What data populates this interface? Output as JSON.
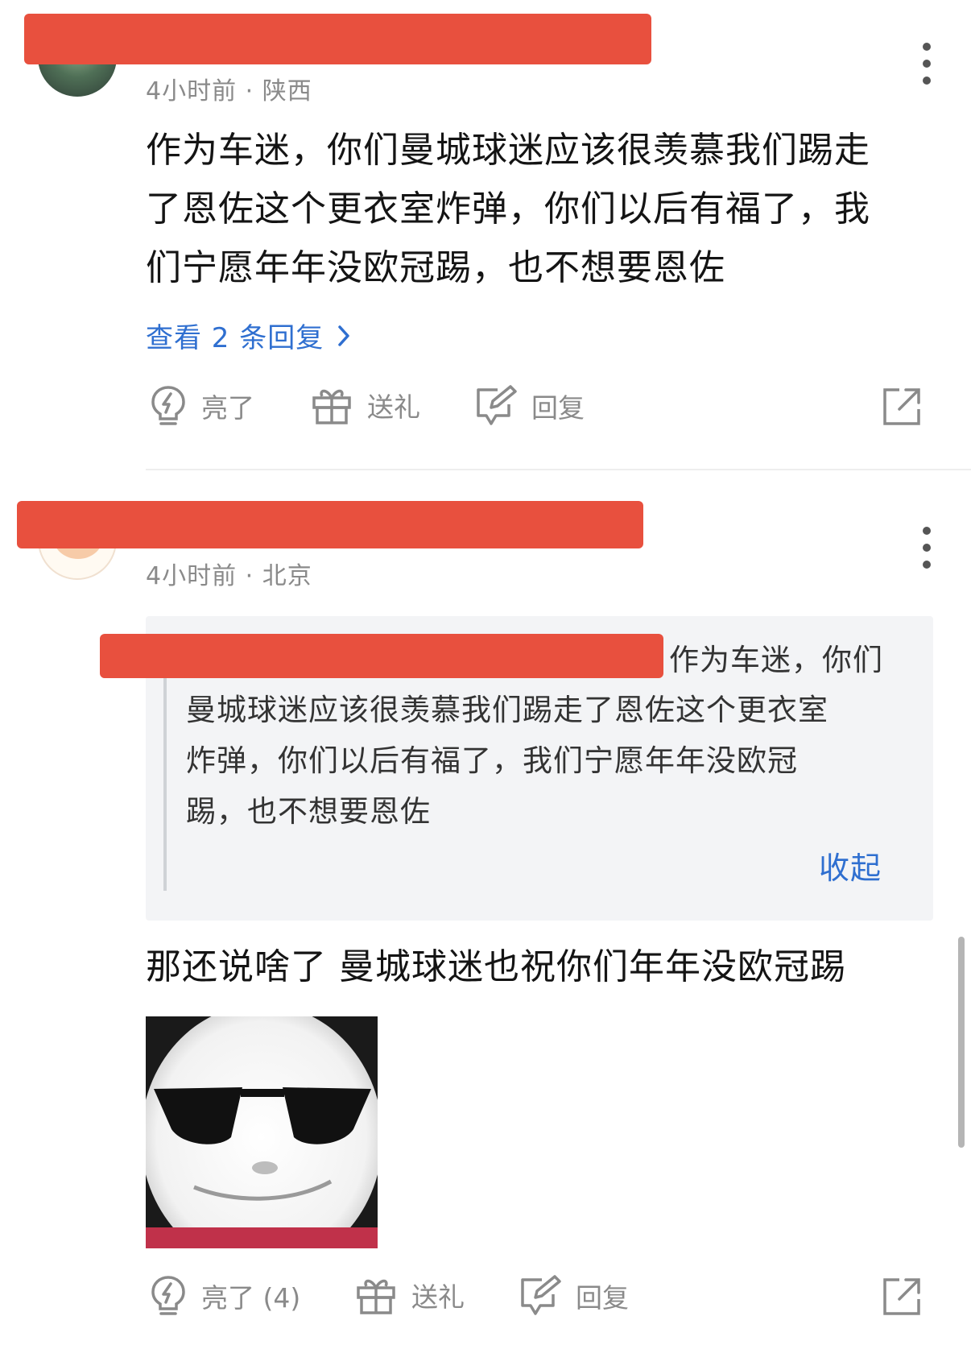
{
  "comments": [
    {
      "meta": "4小时前 · 陕西",
      "lines": [
        "作为车迷，你们曼城球迷应该很羡慕我们踢走",
        "了恩佐这个更衣室炸弹，你们以后有福了，我",
        "们宁愿年年没欧冠踢，也不想要恩佐"
      ],
      "view_replies": "查看 2 条回复",
      "actions": {
        "like": "亮了",
        "gift": "送礼",
        "reply": "回复"
      }
    },
    {
      "meta": "4小时前 · 北京",
      "quote": {
        "first_line_tail": "作为车迷，你们",
        "lines": [
          "曼城球迷应该很羡慕我们踢走了恩佐这个更衣室",
          "炸弹，你们以后有福了，我们宁愿年年没欧冠",
          "踢，也不想要恩佐"
        ],
        "collapse": "收起"
      },
      "text": "那还说啥了 曼城球迷也祝你们年年没欧冠踢",
      "actions": {
        "like": "亮了 (4)",
        "gift": "送礼",
        "reply": "回复"
      }
    }
  ],
  "colors": {
    "redaction": "#e8503e",
    "link": "#2f6fd0",
    "meta": "#8a8a8a"
  },
  "icons": [
    "more-vertical-icon",
    "lightbulb-icon",
    "gift-icon",
    "reply-edit-icon",
    "share-external-icon",
    "chevron-right-icon"
  ]
}
